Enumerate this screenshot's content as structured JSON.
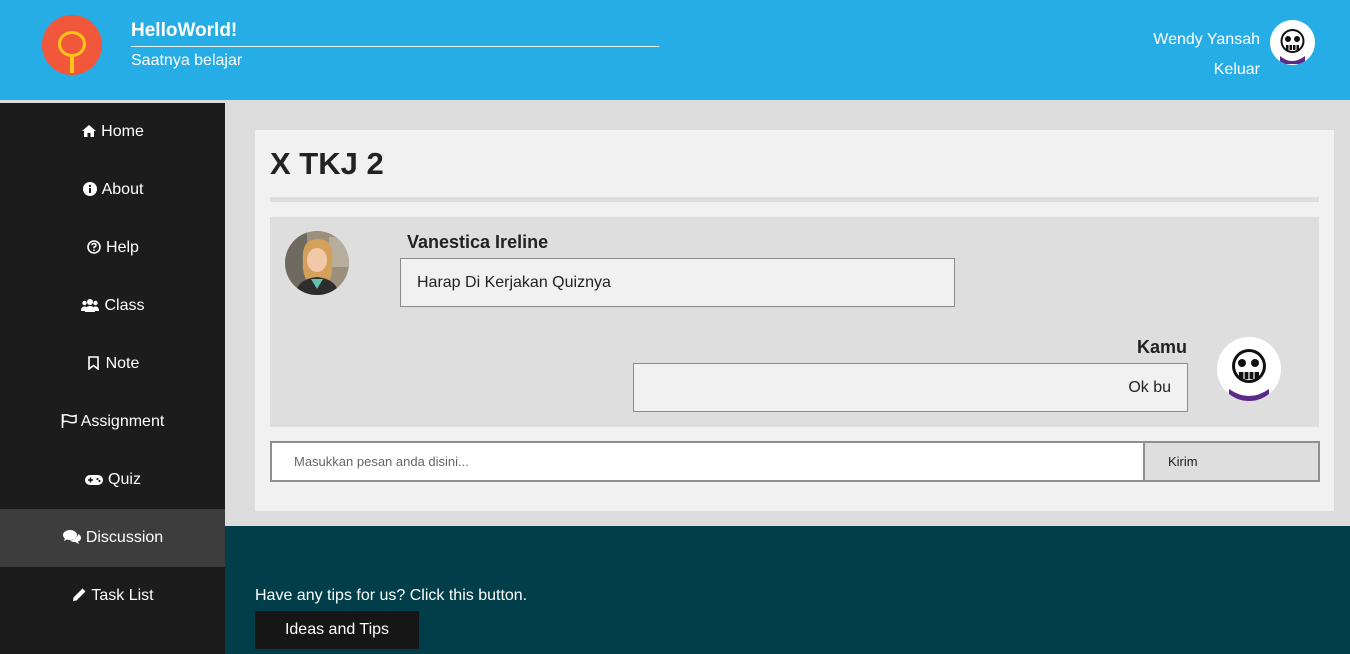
{
  "header": {
    "title": "HelloWorld!",
    "subtitle": "Saatnya belajar",
    "user_name": "Wendy Yansah",
    "logout": "Keluar"
  },
  "sidebar": {
    "items": [
      {
        "label": "Home",
        "icon": "home-icon"
      },
      {
        "label": "About",
        "icon": "info-icon"
      },
      {
        "label": "Help",
        "icon": "question-icon"
      },
      {
        "label": "Class",
        "icon": "users-icon"
      },
      {
        "label": "Note",
        "icon": "bookmark-icon"
      },
      {
        "label": "Assignment",
        "icon": "flag-icon"
      },
      {
        "label": "Quiz",
        "icon": "gamepad-icon"
      },
      {
        "label": "Discussion",
        "icon": "comments-icon",
        "active": true
      },
      {
        "label": "Task List",
        "icon": "pencil-icon"
      }
    ]
  },
  "main": {
    "class_title": "X TKJ 2",
    "messages": [
      {
        "sender": "Vanestica Ireline",
        "text": "Harap Di Kerjakan Quiznya"
      },
      {
        "sender": "Kamu",
        "text": "Ok bu"
      }
    ],
    "input_placeholder": "Masukkan pesan anda disini...",
    "send_label": "Kirim"
  },
  "footer": {
    "tips_text": "Have any tips for us? Click this button.",
    "tips_button": "Ideas and Tips"
  },
  "colors": {
    "header_bg": "#27ade6",
    "sidebar_bg": "#1c1c1c",
    "sidebar_active": "#3d3d3d",
    "footer_bg": "#003f4a",
    "logo_bg": "#f0573b",
    "logo_accent": "#ffc61a"
  }
}
